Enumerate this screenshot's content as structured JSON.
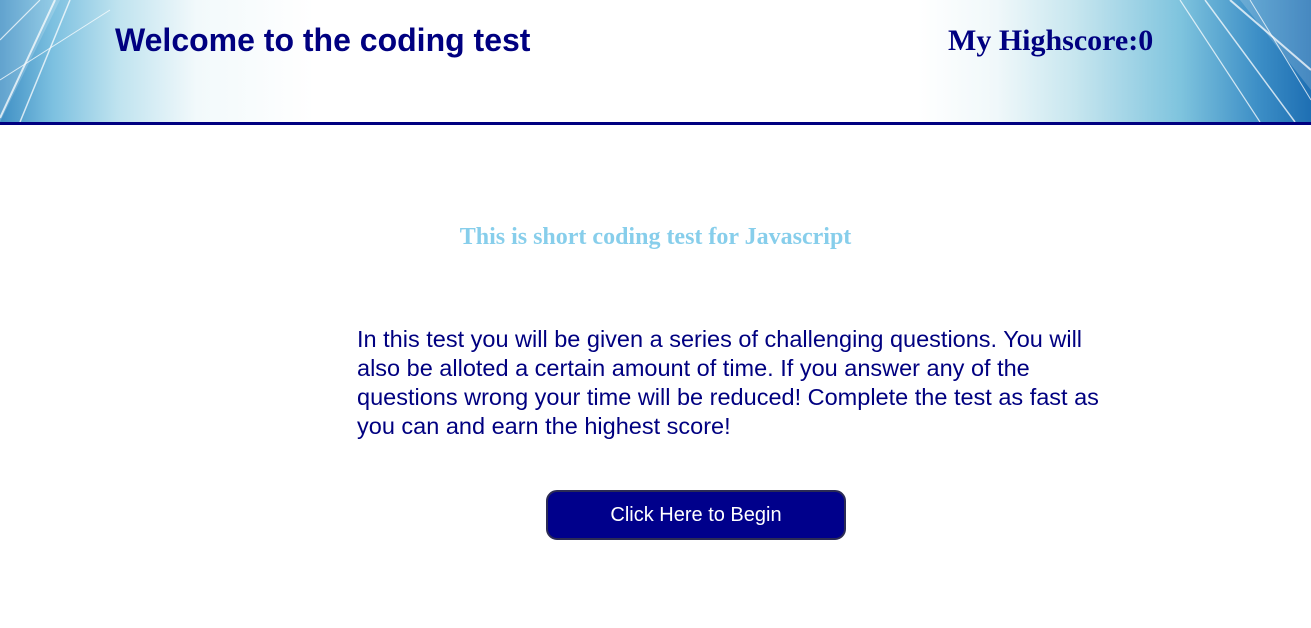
{
  "header": {
    "title": "Welcome to the coding test",
    "highscore": "My Highscore:0"
  },
  "main": {
    "subtitle": "This is short coding test for Javascript",
    "intro": "In this test you will be given a series of challenging questions. You will also be alloted a certain amount of time. If you answer any of the questions wrong your time will be reduced! Complete the test as fast as you can and earn the highest score!",
    "begin_label": "Click Here to Begin"
  },
  "colors": {
    "primary": "#000080",
    "subtitle": "#87ceeb",
    "button": "#00008b"
  }
}
